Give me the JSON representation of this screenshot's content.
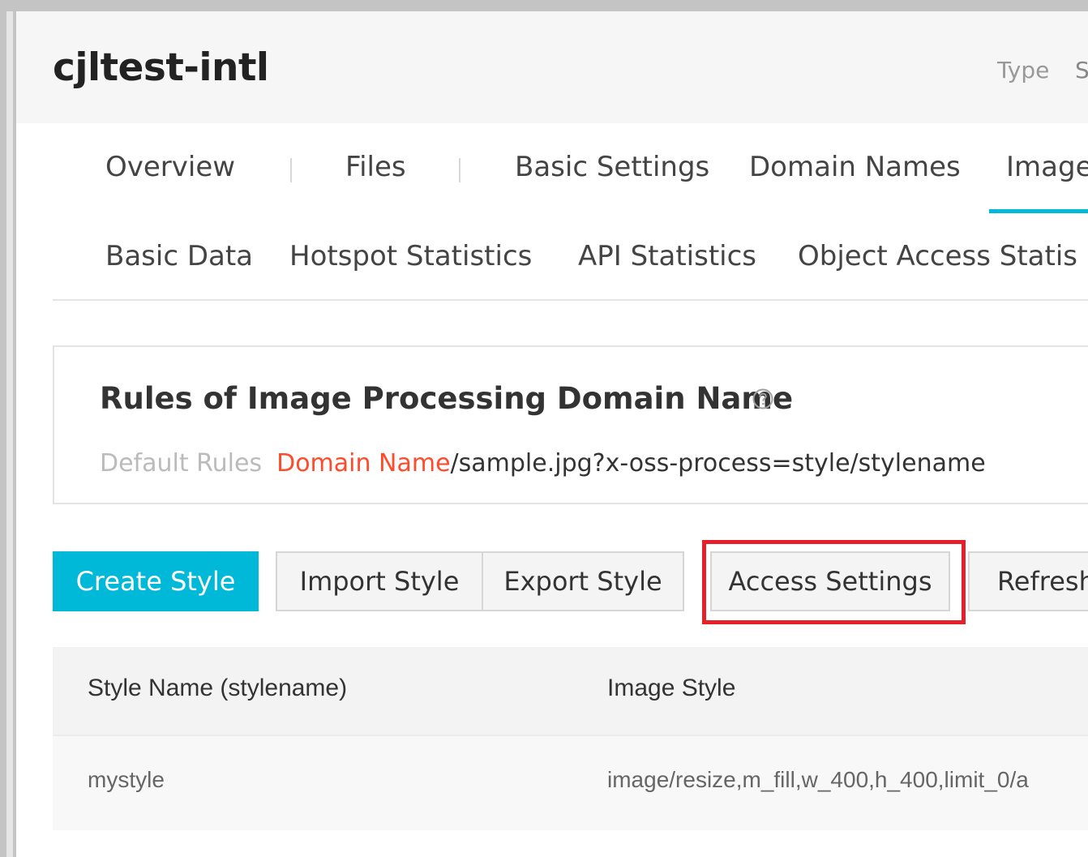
{
  "header": {
    "bucket_name": "cjltest-intl",
    "type_label": "Type",
    "type_value_partial": "S"
  },
  "tabs": [
    {
      "label": "Overview",
      "active": false
    },
    {
      "label": "Files",
      "active": false
    },
    {
      "label": "Basic Settings",
      "active": false
    },
    {
      "label": "Domain Names",
      "active": false
    },
    {
      "label": "Image",
      "active": true
    }
  ],
  "subtabs": [
    {
      "label": "Basic Data"
    },
    {
      "label": "Hotspot Statistics"
    },
    {
      "label": "API Statistics"
    },
    {
      "label": "Object Access Statis"
    }
  ],
  "rules": {
    "title": "Rules of Image Processing Domain Name",
    "help_icon": "question-circle-icon",
    "default_label": "Default Rules",
    "domain_placeholder": "Domain Name",
    "path": "/sample.jpg?x-oss-process=style/stylename"
  },
  "toolbar": {
    "create_label": "Create Style",
    "import_label": "Import Style",
    "export_label": "Export Style",
    "access_label": "Access Settings",
    "refresh_label": "Refresh"
  },
  "table": {
    "columns": [
      "Style Name (stylename)",
      "Image Style"
    ],
    "rows": [
      [
        "mystyle",
        "image/resize,m_fill,w_400,h_400,limit_0/a"
      ]
    ]
  },
  "colors": {
    "accent": "#00b8d8",
    "highlight": "#e4202b",
    "domain_name": "#ff4b2b"
  }
}
